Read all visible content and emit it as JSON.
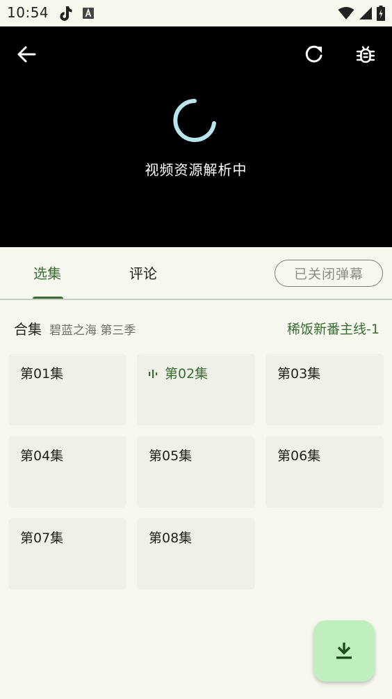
{
  "status_bar": {
    "time": "10:54",
    "icons": [
      "tiktok-icon",
      "a-box-icon",
      "wifi-icon",
      "signal-icon",
      "battery-icon"
    ]
  },
  "player": {
    "loading_text": "视频资源解析中",
    "spinner_color": "#b9e4ec"
  },
  "tabs": {
    "items": [
      {
        "label": "选集",
        "active": true
      },
      {
        "label": "评论",
        "active": false
      }
    ],
    "danmaku_label": "已关闭弹幕"
  },
  "collection": {
    "label": "合集",
    "subtitle": "碧蓝之海 第三季",
    "source": "稀饭新番主线-1"
  },
  "episodes": [
    {
      "label": "第01集",
      "playing": false
    },
    {
      "label": "第02集",
      "playing": true
    },
    {
      "label": "第03集",
      "playing": false
    },
    {
      "label": "第04集",
      "playing": false
    },
    {
      "label": "第05集",
      "playing": false
    },
    {
      "label": "第06集",
      "playing": false
    },
    {
      "label": "第07集",
      "playing": false
    },
    {
      "label": "第08集",
      "playing": false
    }
  ],
  "colors": {
    "accent": "#3a6b35",
    "background": "#f6f8ef",
    "card": "#eff1e8",
    "fab": "#bfefbf"
  },
  "fab": {
    "icon": "download-icon"
  }
}
